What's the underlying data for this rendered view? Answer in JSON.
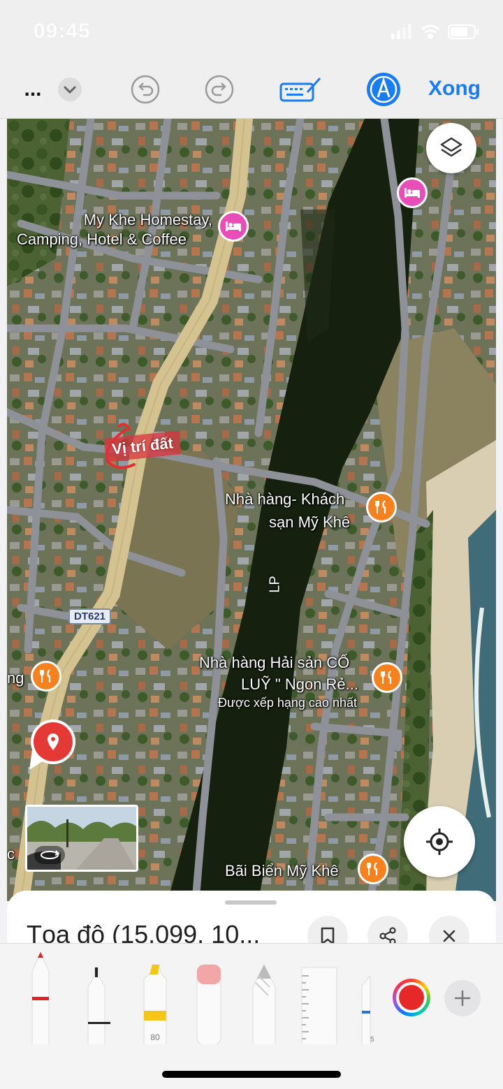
{
  "status": {
    "time": "09:45"
  },
  "toolbar": {
    "more_label": "...",
    "done_label": "Xong"
  },
  "map": {
    "road_label": "DT621",
    "river_label": "LP",
    "annotation": "Vị trí đất",
    "places": [
      {
        "name": "My Khe Homestay,",
        "name2": "Camping, Hotel & Coffee",
        "type": "hotel"
      },
      {
        "name": "Nhà hàng- Khách",
        "name2": "sạn Mỹ Khê",
        "type": "restaurant"
      },
      {
        "name": "Nhà hàng Hải sản CỔ",
        "name2": "LUỸ \" Ngon Rẻ...",
        "sub": "Được xếp hạng cao nhất",
        "type": "restaurant"
      },
      {
        "name": "Bãi Biển Mỹ Khê",
        "type": "restaurant"
      },
      {
        "name": "ng",
        "type": "restaurant"
      }
    ],
    "edge_label": "c"
  },
  "sheet": {
    "title": "Tọa độ (15.099, 10..."
  },
  "markup_tools": {
    "highlighter_size": "80",
    "ruler_mark": "5",
    "selected_color": "#e62828"
  },
  "colors": {
    "accent": "#1a7cf2",
    "hotel_pin": "#e94db8",
    "food_pin": "#f5821f",
    "location_pin": "#e53935"
  }
}
